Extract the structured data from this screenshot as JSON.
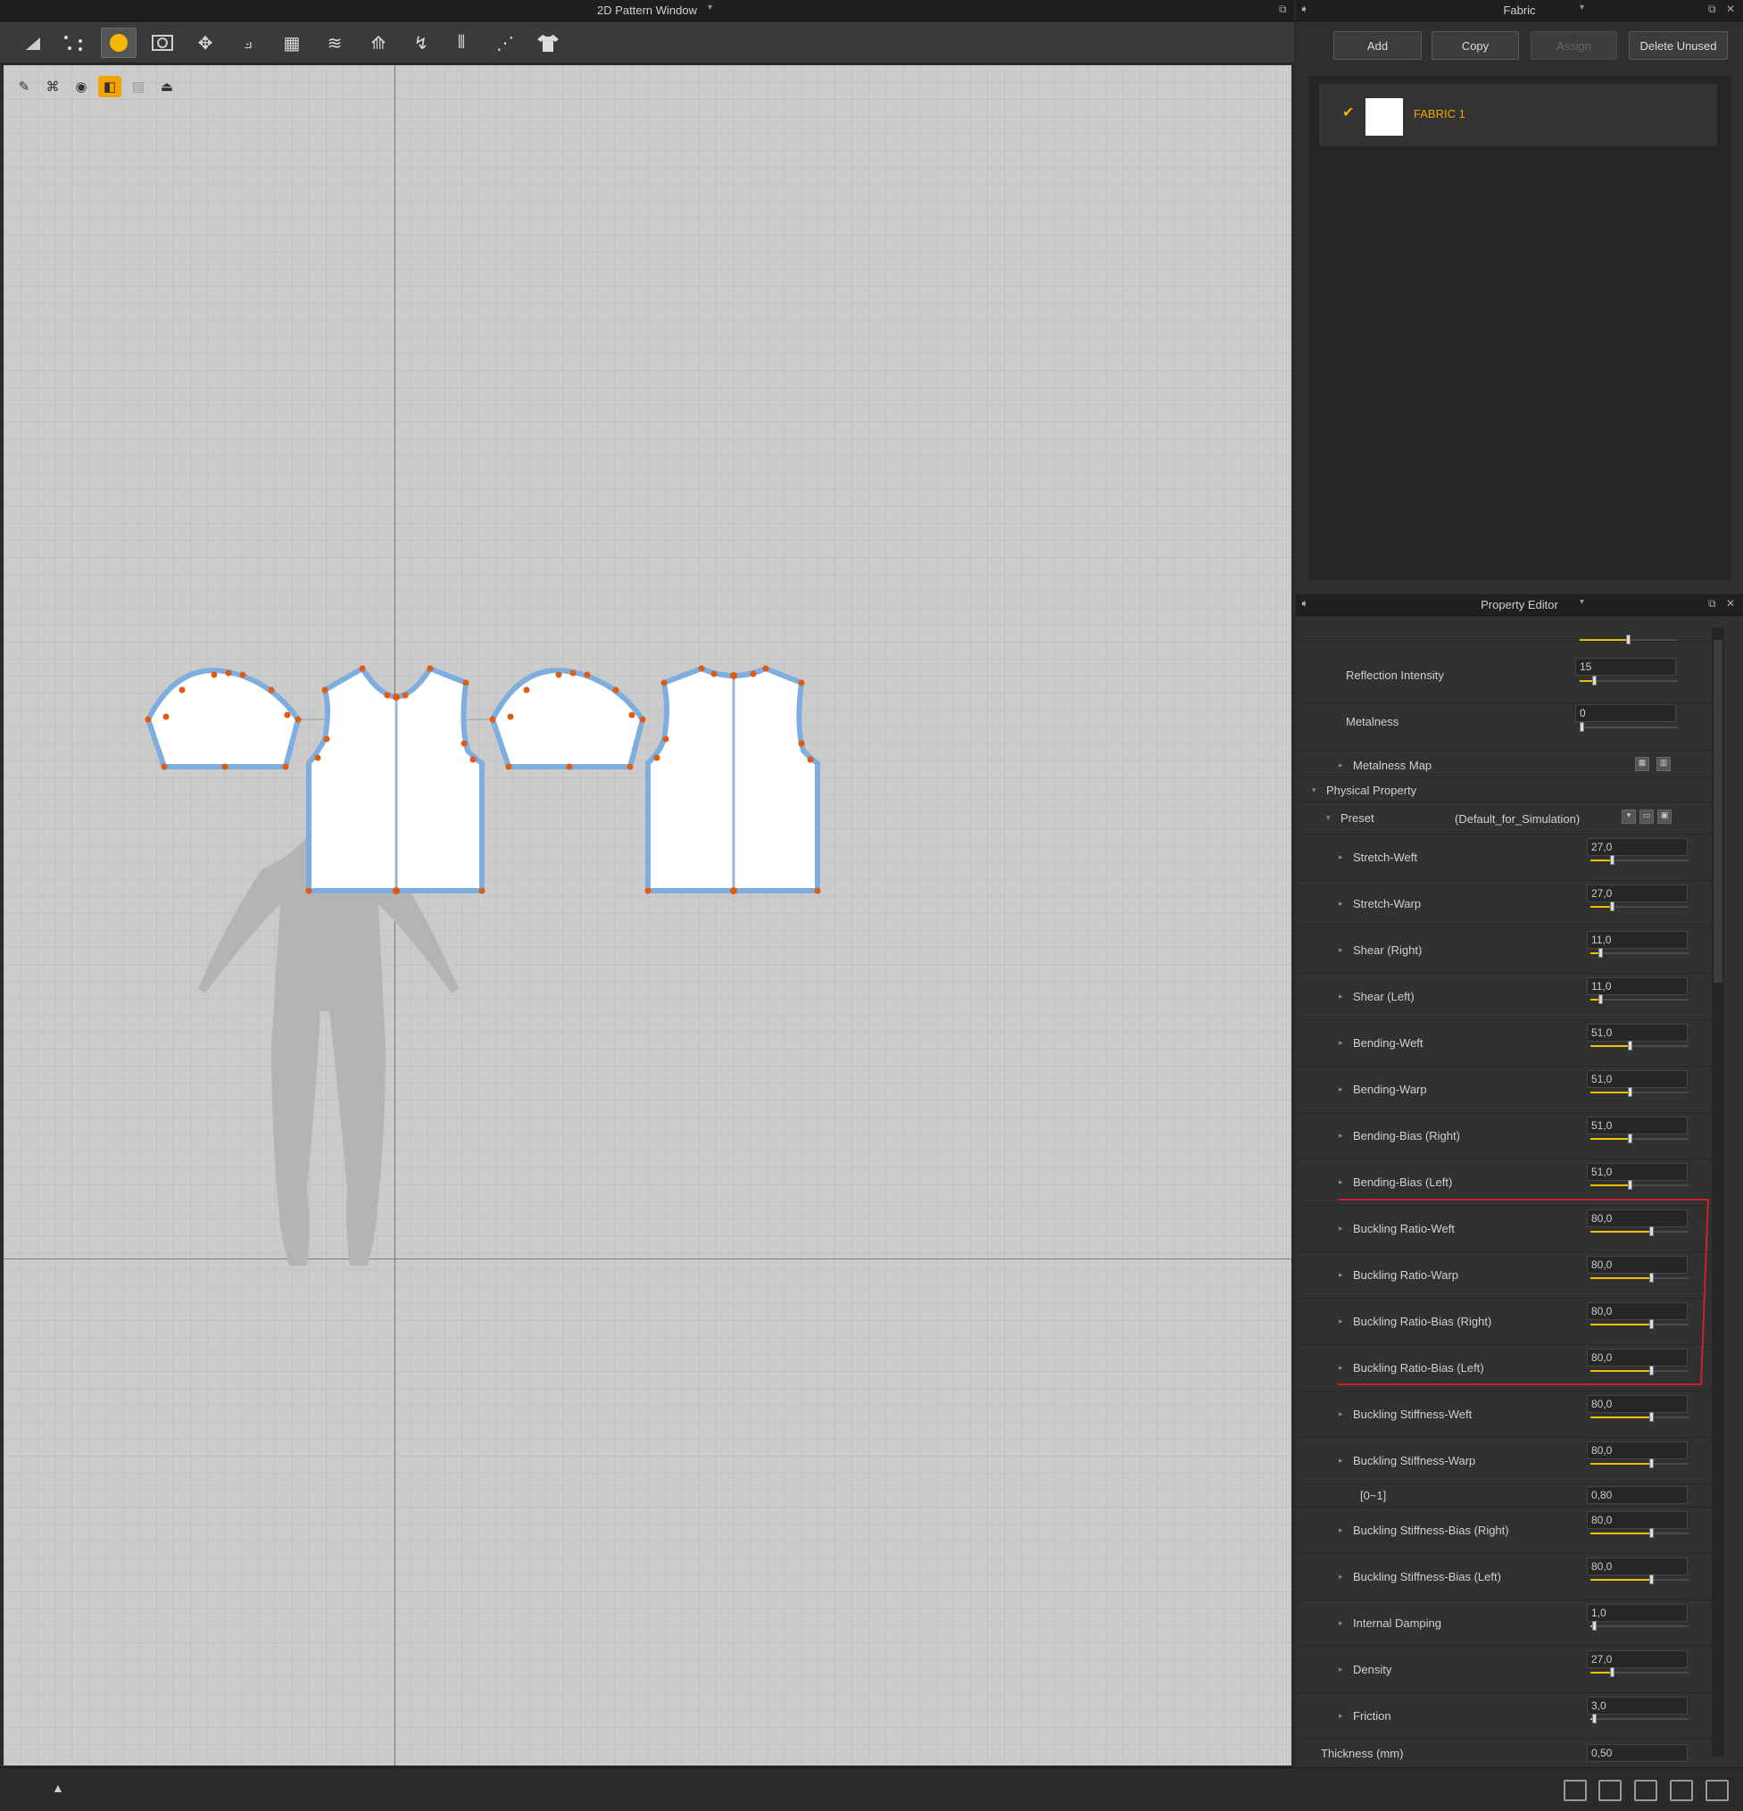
{
  "left_window": {
    "title": "2D Pattern Window"
  },
  "toolbar": {
    "tools": [
      "select-pattern-icon",
      "transform-points-icon",
      "sewing-pattern-icon",
      "internal-shape-icon",
      "avatar-arrangement-icon",
      "fold-arrangement-icon",
      "grid-edit-icon",
      "sewing-icon",
      "segment-sewing-icon",
      "free-sewing-icon",
      "edge-line-icon",
      "topstitch-icon",
      "garment-icon"
    ],
    "subtools": [
      "pen-icon",
      "brush-icon",
      "measure-icon",
      "fabric-select-icon",
      "layer-icon",
      "export-icon"
    ]
  },
  "fabric_panel": {
    "title": "Fabric",
    "buttons": {
      "add": "Add",
      "copy": "Copy",
      "assign": "Assign",
      "delete_unused": "Delete Unused"
    },
    "fabrics": [
      {
        "name": "FABRIC 1",
        "checked": true,
        "color": "#ffffff"
      }
    ]
  },
  "property_editor": {
    "title": "Property Editor",
    "reflection_intensity": {
      "label": "Reflection Intensity",
      "value": "15"
    },
    "metalness": {
      "label": "Metalness",
      "value": "0"
    },
    "metalness_map": {
      "label": "Metalness Map"
    },
    "physical_property": {
      "label": "Physical Property"
    },
    "preset": {
      "label": "Preset",
      "value": "(Default_for_Simulation)"
    },
    "rows": [
      {
        "label": "Stretch-Weft",
        "value": "27,0",
        "fill": 0.27
      },
      {
        "label": "Stretch-Warp",
        "value": "27,0",
        "fill": 0.27
      },
      {
        "label": "Shear (Right)",
        "value": "11,0",
        "fill": 0.11
      },
      {
        "label": "Shear (Left)",
        "value": "11,0",
        "fill": 0.11
      },
      {
        "label": "Bending-Weft",
        "value": "51,0",
        "fill": 0.51
      },
      {
        "label": "Bending-Warp",
        "value": "51,0",
        "fill": 0.51
      },
      {
        "label": "Bending-Bias (Right)",
        "value": "51,0",
        "fill": 0.51
      },
      {
        "label": "Bending-Bias (Left)",
        "value": "51,0",
        "fill": 0.51
      },
      {
        "label": "Buckling Ratio-Weft",
        "value": "80,0",
        "fill": 0.8
      },
      {
        "label": "Buckling Ratio-Warp",
        "value": "80,0",
        "fill": 0.8
      },
      {
        "label": "Buckling Ratio-Bias (Right)",
        "value": "80,0",
        "fill": 0.8
      },
      {
        "label": "Buckling Ratio-Bias (Left)",
        "value": "80,0",
        "fill": 0.8
      },
      {
        "label": "Buckling Stiffness-Weft",
        "value": "80,0",
        "fill": 0.8
      },
      {
        "label": "Buckling Stiffness-Warp",
        "value": "80,0",
        "fill": 0.8
      }
    ],
    "range_row": {
      "label": "[0~1]",
      "value": "0,80"
    },
    "rows2": [
      {
        "label": "Buckling Stiffness-Bias (Right)",
        "value": "80,0",
        "fill": 0.8
      },
      {
        "label": "Buckling Stiffness-Bias (Left)",
        "value": "80,0",
        "fill": 0.8
      },
      {
        "label": "Internal Damping",
        "value": "1,0",
        "fill": 0.02
      },
      {
        "label": "Density",
        "value": "27,0",
        "fill": 0.27
      },
      {
        "label": "Friction",
        "value": "3,0",
        "fill": 0.03
      }
    ],
    "thickness": {
      "label": "Thickness (mm)",
      "value": "0,50"
    }
  },
  "colors": {
    "accent": "#f0a400",
    "slider": "#f0c000",
    "pattern_outline": "#7eaee0",
    "pattern_point": "#e05a10",
    "highlight_box": "#d0202e"
  }
}
